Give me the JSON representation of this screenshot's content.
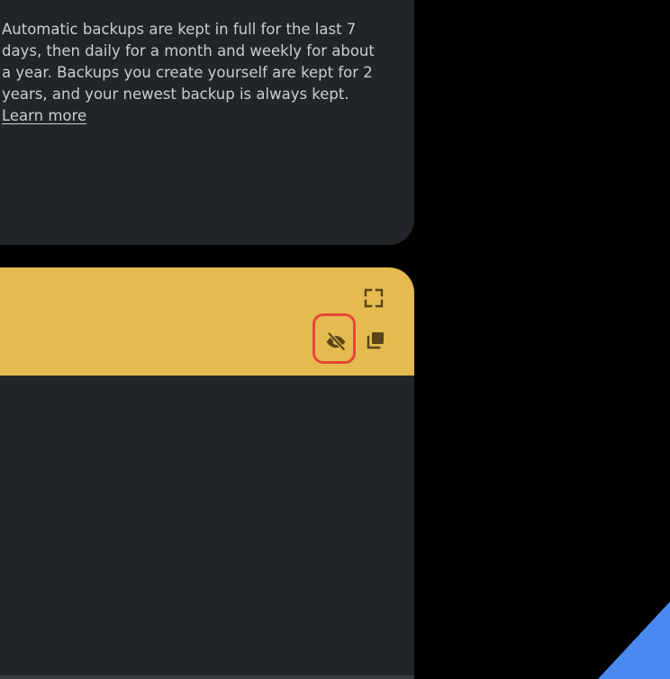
{
  "backup_info": {
    "description": "Automatic backups are kept in full for the last 7 days, then daily for a month and weekly for about a year. Backups you create yourself are kept for 2 years, and your newest backup is always kept.",
    "learn_more_label": "Learn more"
  },
  "key_panel": {
    "icons": {
      "fullscreen": "fullscreen-icon",
      "visibility": "visibility-off-icon",
      "copy": "copy-icon"
    }
  },
  "colors": {
    "background": "#000000",
    "card": "#222528",
    "accent_yellow": "#e3bb4f",
    "icon_dark": "#5a4418",
    "highlight_red": "#e8453c",
    "corner_blue": "#4a8af0",
    "text": "#c9cdd1"
  }
}
